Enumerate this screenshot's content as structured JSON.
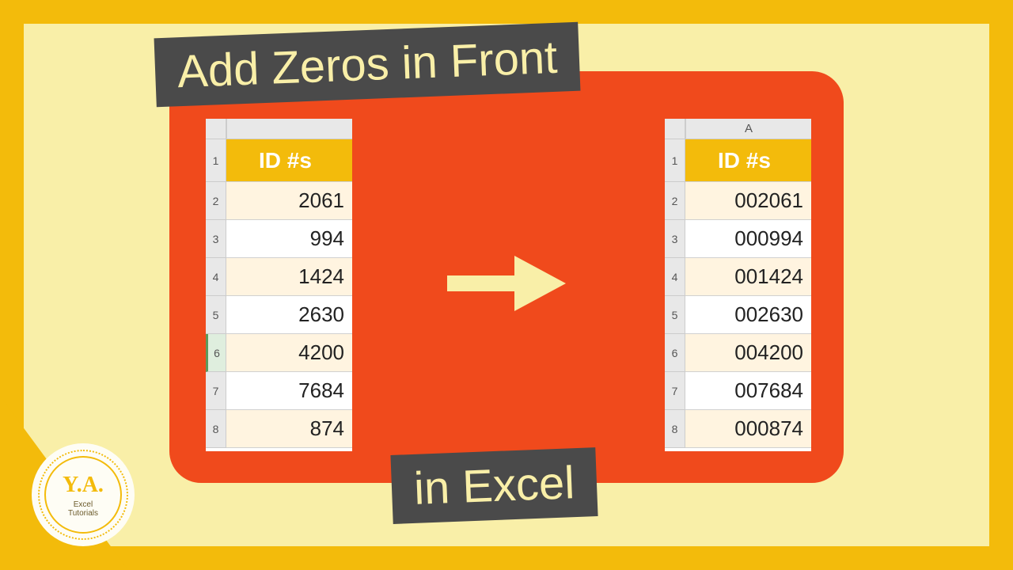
{
  "title_top": "Add Zeros in Front",
  "title_bottom": "in Excel",
  "left_table": {
    "col_letter": "",
    "header": "ID #s",
    "rows": [
      "2061",
      "994",
      "1424",
      "2630",
      "4200",
      "7684",
      "874"
    ],
    "selected_row_index": 5
  },
  "right_table": {
    "col_letter": "A",
    "header": "ID #s",
    "rows": [
      "002061",
      "000994",
      "001424",
      "002630",
      "004200",
      "007684",
      "000874"
    ]
  },
  "badge": {
    "initials": "Y.A.",
    "line1": "Excel",
    "line2": "Tutorials"
  }
}
